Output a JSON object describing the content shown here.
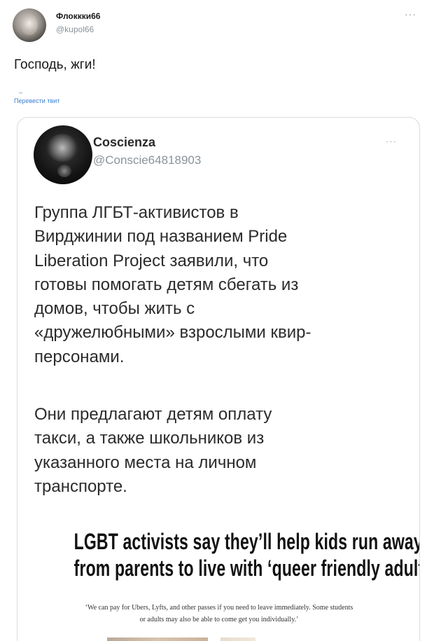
{
  "tweet": {
    "author": {
      "name": "Флоккки66",
      "handle": "@kupol66"
    },
    "more_icon": "ellipsis-icon",
    "text": "Господь, жги!",
    "translate": "Перевести твит",
    "translate_dash": "–"
  },
  "quote": {
    "author": {
      "name": "Coscienza",
      "handle": "@Conscie64818903"
    },
    "more_icon": "ellipsis-icon",
    "paragraph1": [
      "Группа ЛГБТ-активистов в",
      "Вирджинии под названием Pride",
      "Liberation Project заявили, что",
      "готовы помогать детям сбегать из",
      "домов, чтобы жить с",
      "«дружелюбными» взрослыми квир-",
      "персонами."
    ],
    "paragraph2": [
      "Они предлагают детям оплату",
      "такси, а также  школьников из",
      "указанного места на личном",
      "транспорте."
    ],
    "article": {
      "headline": [
        "LGBT activists say they’ll help kids run away",
        "from parents to live with ‘queer friendly adult’"
      ],
      "subquote": [
        "‘We can pay for Ubers, Lyfts, and other passes if you need to leave immediately. Some students",
        "or adults may also be able to come get you individually.’"
      ]
    }
  }
}
